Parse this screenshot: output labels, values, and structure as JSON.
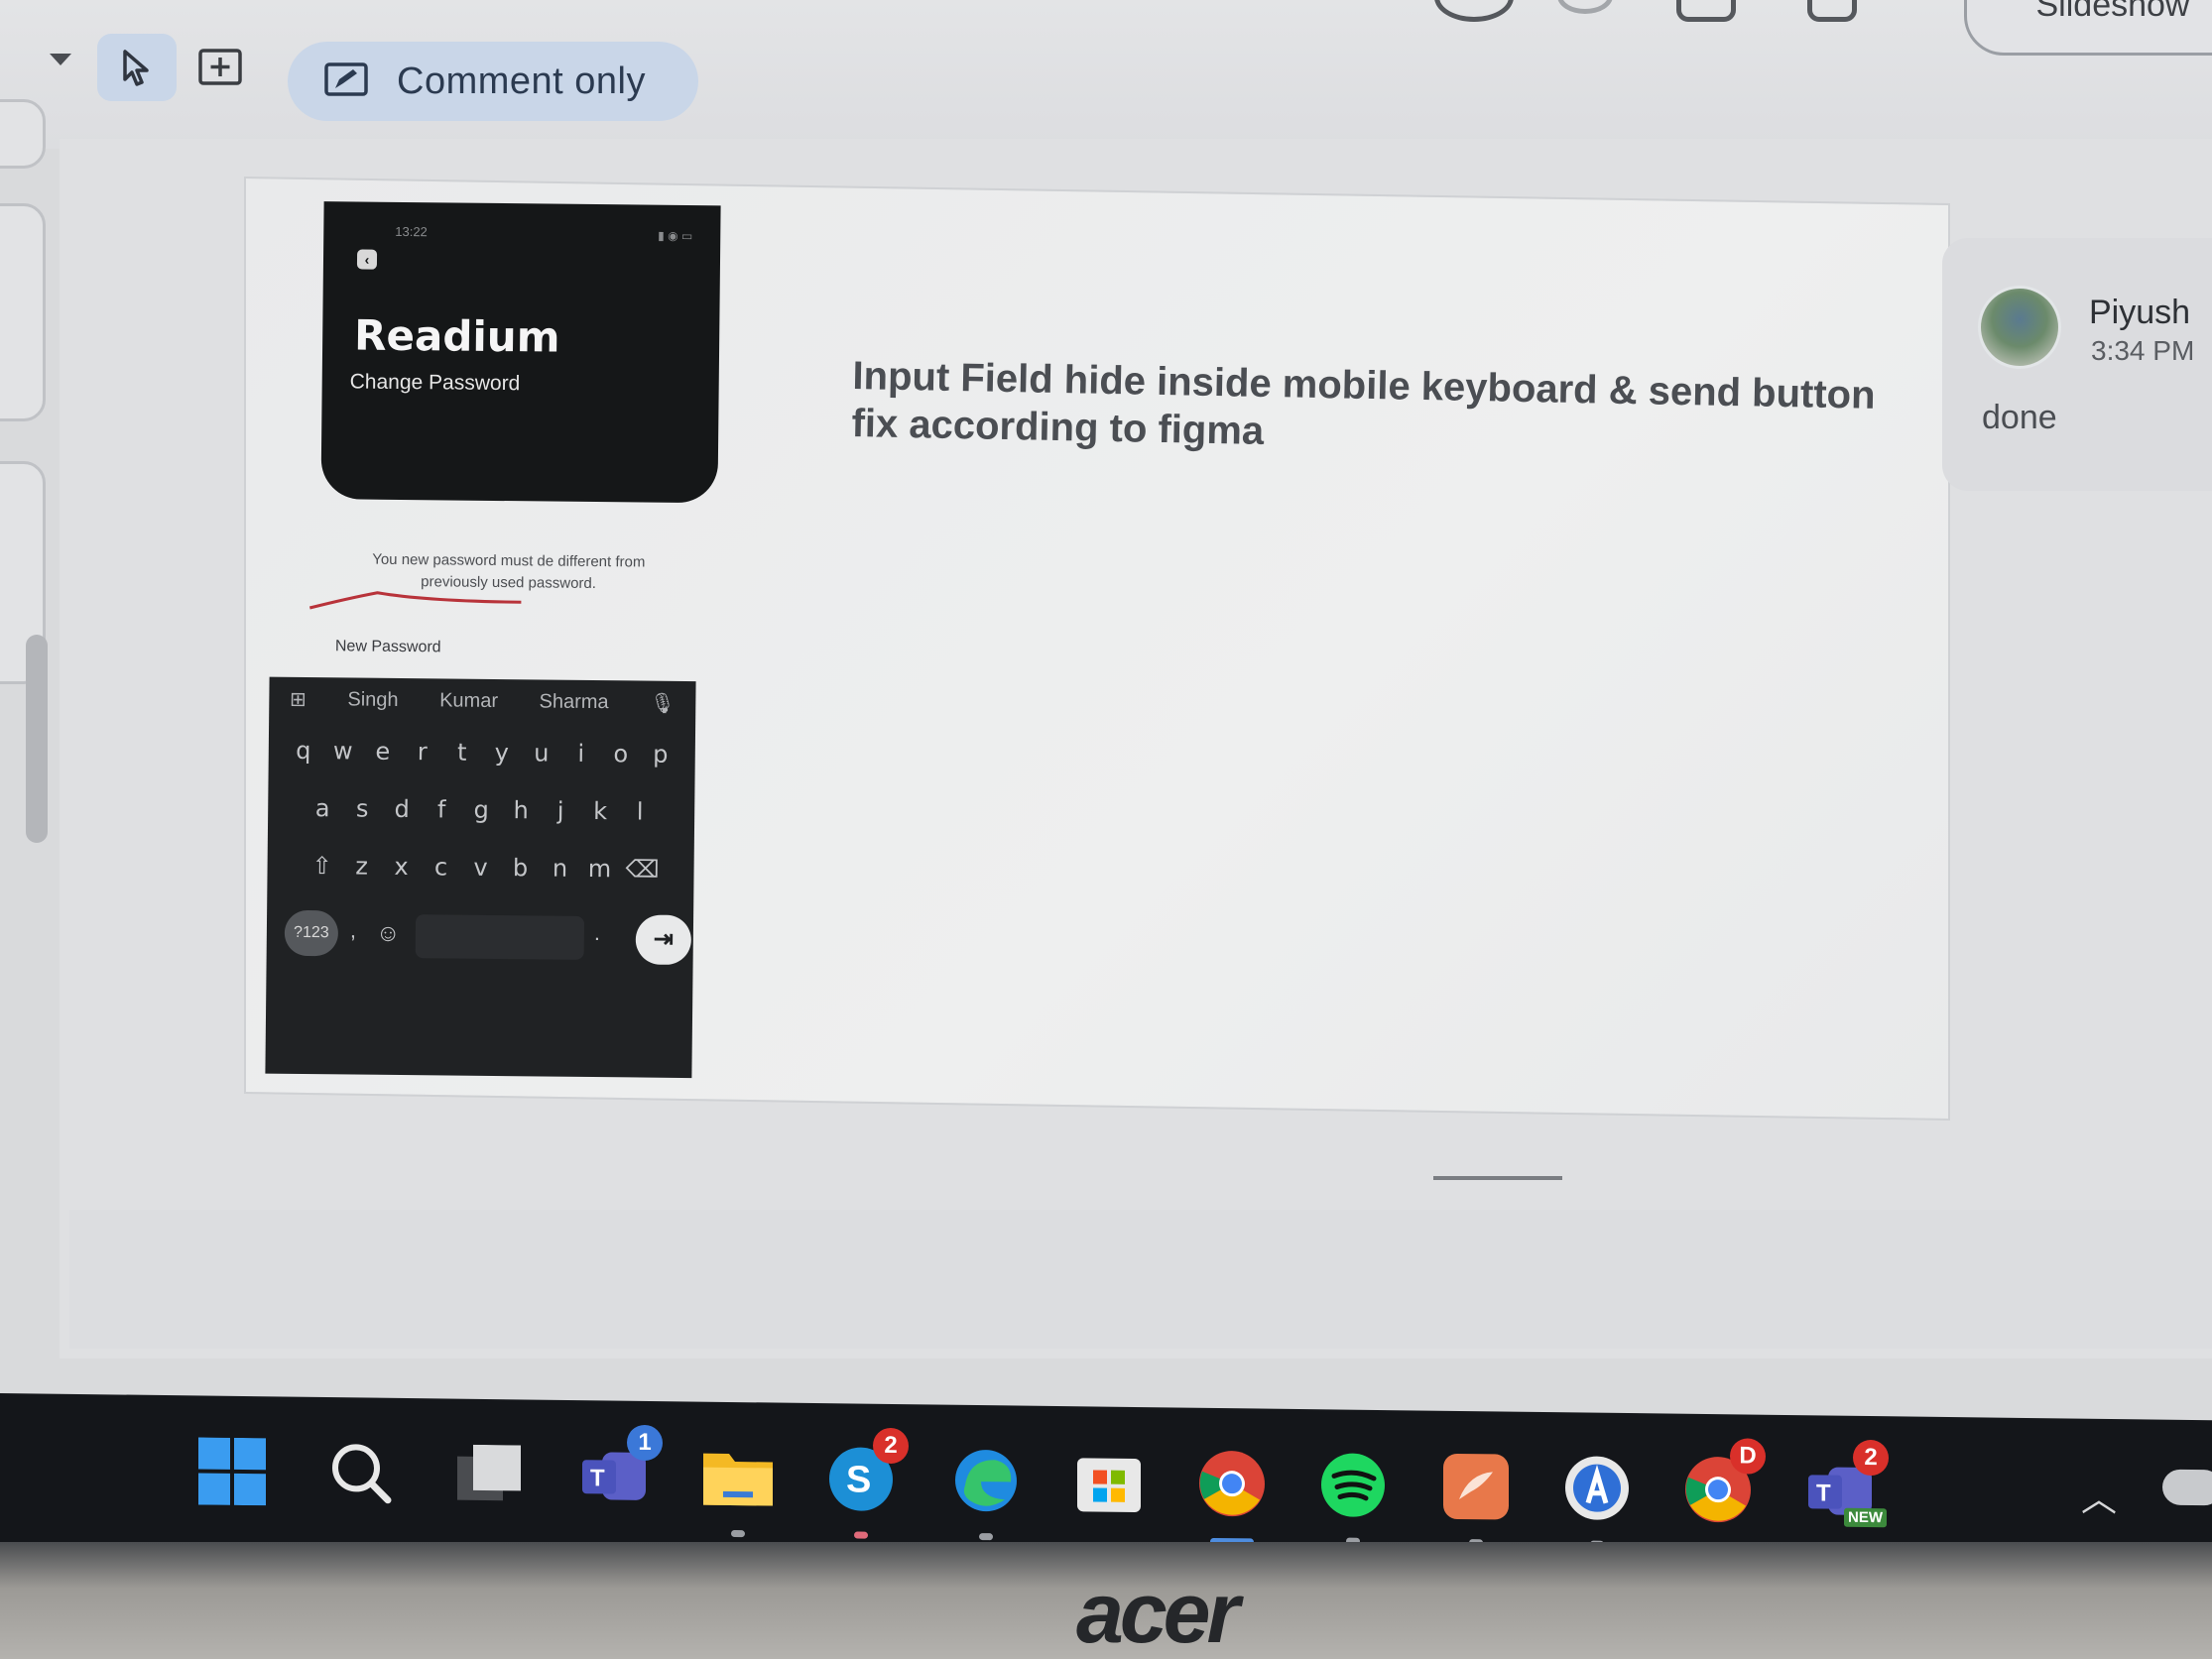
{
  "toolbar": {
    "mode_label": "Comment only",
    "slideshow_label": "Slideshow"
  },
  "slide": {
    "app_brand": "Readium",
    "screen_title": "Change Password",
    "status_time": "13:22",
    "helper_text": "You new password must de different from previously used password.",
    "field_label": "New Password",
    "keyboard": {
      "suggestions": [
        "Singh",
        "Kumar",
        "Sharma"
      ],
      "row1": [
        "q",
        "w",
        "e",
        "r",
        "t",
        "y",
        "u",
        "i",
        "o",
        "p"
      ],
      "row2": [
        "a",
        "s",
        "d",
        "f",
        "g",
        "h",
        "j",
        "k",
        "l"
      ],
      "row3": [
        "z",
        "x",
        "c",
        "v",
        "b",
        "n",
        "m"
      ],
      "num_key": "?123"
    },
    "comment": "Input Field hide inside mobile keyboard & send button fix according to figma"
  },
  "comment_thread": {
    "author": "Piyush",
    "time": "3:34 PM",
    "reply": "done"
  },
  "taskbar": {
    "badges": {
      "teams_classic": "1",
      "skype": "2",
      "chrome_profile_letter": "D",
      "teams_new": "2",
      "teams_new_tag": "NEW"
    },
    "icons": [
      "windows-start-icon",
      "search-icon",
      "task-view-icon",
      "teams-classic-icon",
      "file-explorer-icon",
      "skype-icon",
      "edge-icon",
      "microsoft-store-icon",
      "chrome-icon",
      "spotify-icon",
      "app-orange-icon",
      "app-blue-a-icon",
      "chrome-profile-icon",
      "teams-new-icon"
    ]
  },
  "bezel": {
    "logo": "acer"
  },
  "colors": {
    "accent_pill": "#c9d6e8",
    "brand_yellow": "#f2c12e",
    "taskbar_bg": "#14161a",
    "badge_red": "#d9302a"
  }
}
